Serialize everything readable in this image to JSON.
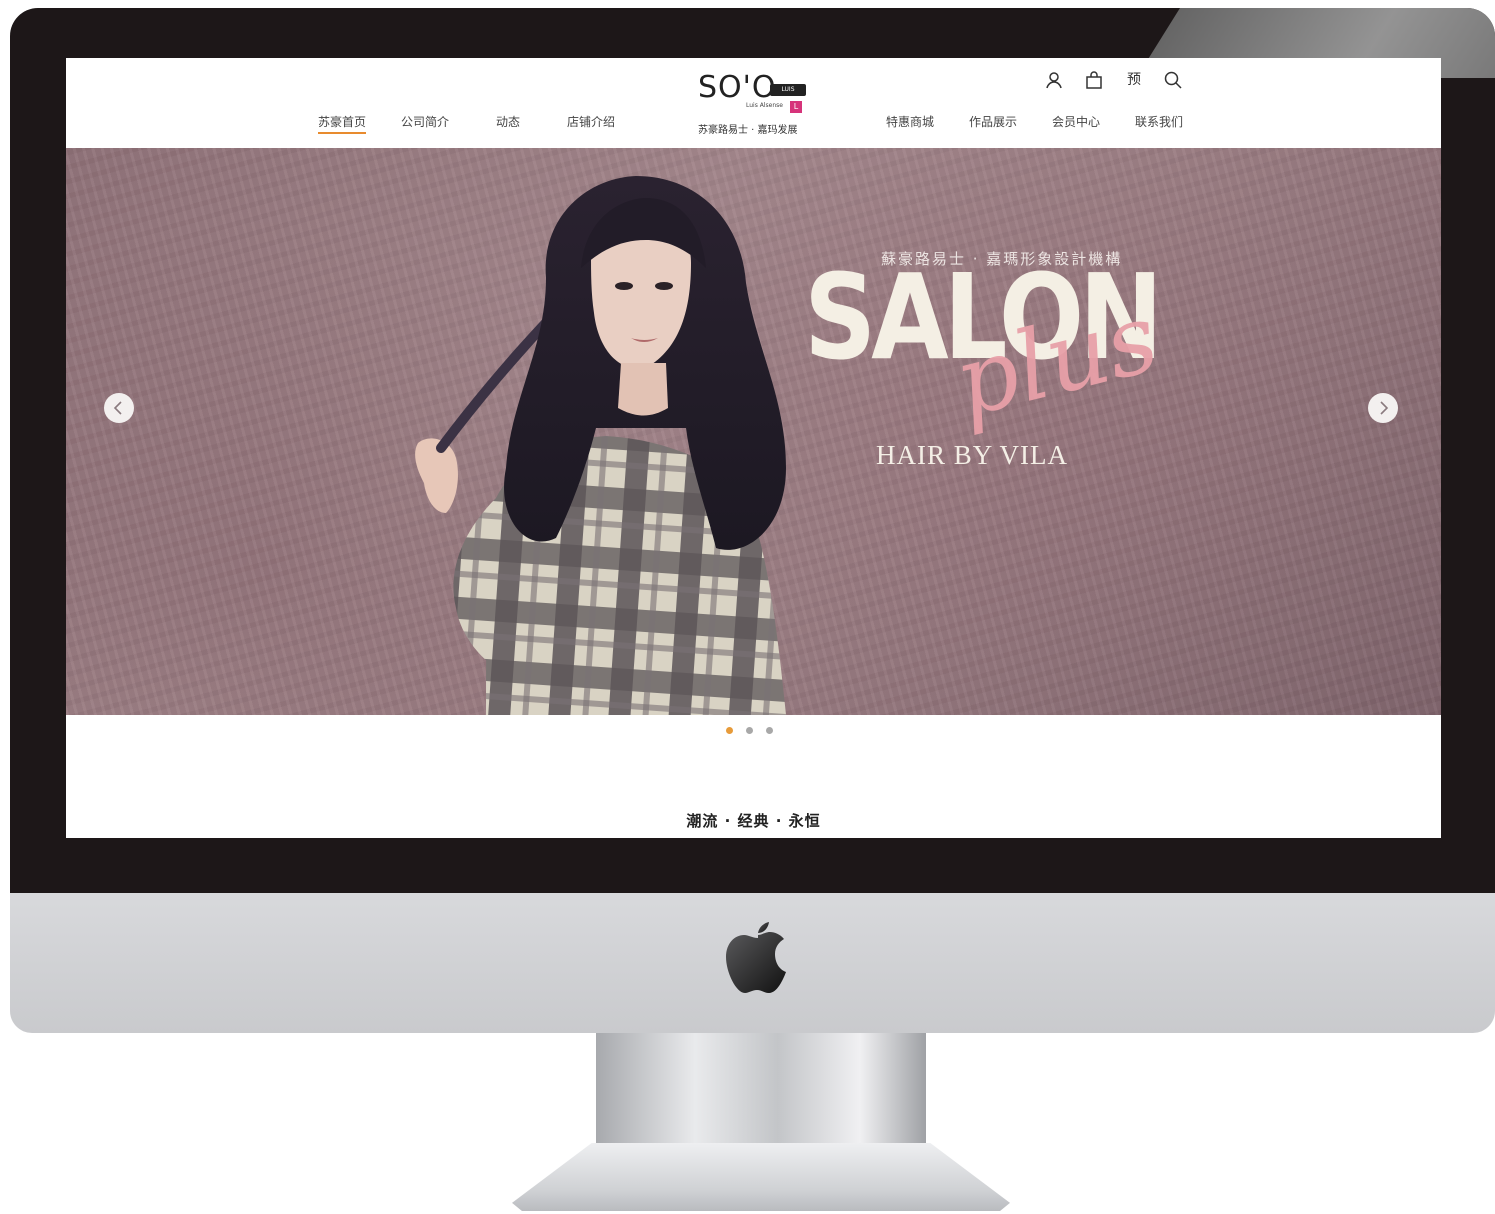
{
  "nav_left": [
    {
      "label": "苏豪首页",
      "active": true
    },
    {
      "label": "公司简介",
      "active": false
    },
    {
      "label": "动态",
      "active": false
    },
    {
      "label": "店铺介绍",
      "active": false
    }
  ],
  "nav_right": [
    {
      "label": "特惠商城"
    },
    {
      "label": "作品展示"
    },
    {
      "label": "会员中心"
    },
    {
      "label": "联系我们"
    }
  ],
  "logo": {
    "main": "SO'O",
    "badge": "LUIS",
    "sub": "Luis Alsense",
    "pink_mark": "L",
    "cn": "苏豪路易士 · 嘉玛发展"
  },
  "header_icons": {
    "user": "user-icon",
    "bag": "bag-icon",
    "reserve_char": "预",
    "search": "search-icon"
  },
  "hero": {
    "subtitle": "蘇豪路易士 · 嘉瑪形象設計機構",
    "title": "SALON",
    "script": "plus",
    "tagline": "HAIR BY VILA"
  },
  "carousel": {
    "slide_count": 3,
    "active_index": 0,
    "active_color": "#e79b3a"
  },
  "slogan": "潮流 · 经典 · 永恒",
  "colors": {
    "accent": "#e88b2e",
    "hero_bg": "#9a7c82",
    "script_pink": "#e8a0a8"
  }
}
